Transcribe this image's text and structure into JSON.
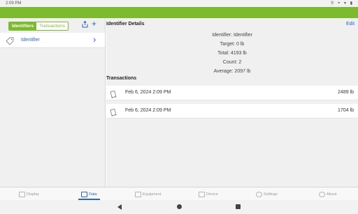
{
  "status_bar": {
    "time": "2:09 PM",
    "icons": "⚲ ⌖ ▾ ▮"
  },
  "left_panel": {
    "segments": [
      {
        "label": "Identifiers",
        "active": true
      },
      {
        "label": "Transactions",
        "active": false
      }
    ],
    "share_icon": "share-icon",
    "add_icon": "plus-icon",
    "items": [
      {
        "label": "Identifier",
        "icon": "tag-icon"
      }
    ]
  },
  "details": {
    "title": "Identifier Details",
    "edit_label": "Edit",
    "lines": [
      "Identifier: Identifier",
      "Target: 0 lb",
      "Total: 4193 lb",
      "Count: 2",
      "Average: 2097 lb"
    ],
    "transactions_title": "Transactions",
    "transactions": [
      {
        "date": "Feb 6, 2024 2:09 PM",
        "amount": "2489 lb",
        "icon": "receipt-icon"
      },
      {
        "date": "Feb 6, 2024 2:09 PM",
        "amount": "1704 lb",
        "icon": "receipt-icon"
      }
    ]
  },
  "tabs": [
    {
      "label": "Display",
      "active": false
    },
    {
      "label": "Data",
      "active": true
    },
    {
      "label": "Equipment",
      "active": false
    },
    {
      "label": "Device",
      "active": false
    },
    {
      "label": "Settings",
      "active": false
    },
    {
      "label": "About",
      "active": false
    }
  ],
  "colors": {
    "brand_green": "#7dba2f",
    "link_blue": "#2a62c9"
  }
}
